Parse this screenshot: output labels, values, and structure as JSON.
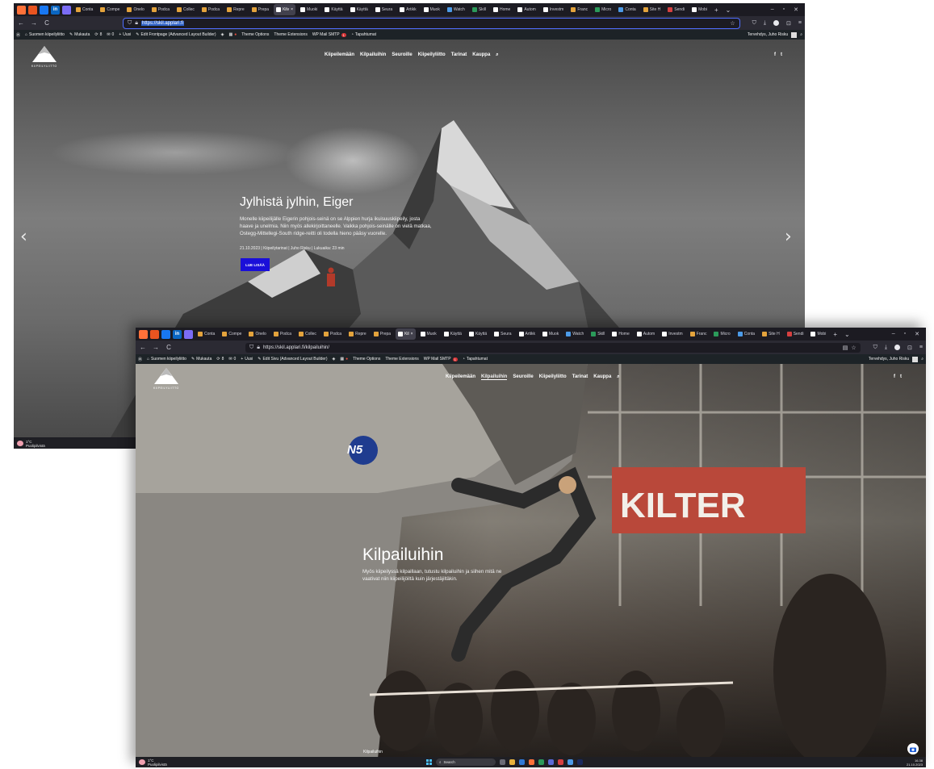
{
  "browser": {
    "pinned": [
      {
        "icon": "firefox-icon",
        "color": "#ff7139"
      },
      {
        "icon": "app-icon",
        "color": "#e95420"
      },
      {
        "icon": "facebook-icon",
        "color": "#1877f2"
      },
      {
        "icon": "linkedin-icon",
        "color": "#0a66c2",
        "glyph": "in"
      },
      {
        "icon": "app-square-icon",
        "color": "#7b6cf6"
      }
    ],
    "tabs": [
      "Conta",
      "Compe",
      "Onelo",
      "Podca",
      "Collec",
      "Podca",
      "Repre",
      "Prepa",
      "Kilv",
      "Muoki",
      "Käyttä",
      "Käyttä",
      "Seura",
      "Artikk",
      "Muok",
      "Watch",
      "Skill",
      "Home",
      "Autom",
      "Investm",
      "Franc",
      "Micro",
      "Conta",
      "Site H",
      "Sendi",
      "Mobi"
    ],
    "tabs_shot2": [
      "Conta",
      "Compe",
      "Onelo",
      "Podca",
      "Collec",
      "Podca",
      "Repre",
      "Prepa",
      "Kil",
      "Muok",
      "Käyttä",
      "Käyttä",
      "Seura",
      "Artikk",
      "Muok",
      "Watch",
      "Skill",
      "Home",
      "Autom",
      "Investm",
      "Franc",
      "Micro",
      "Conta",
      "Site H",
      "Sendi",
      "Mobi"
    ],
    "active_tab_index": 8,
    "new_tab": "+",
    "tab_list": "⌄",
    "win_controls": [
      "–",
      "▫",
      "✕"
    ],
    "url_shot1": "https://skil.applari.fi",
    "url_shot2": "https://skil.applari.fi/kilpailuihin/",
    "nav_icons": [
      "←",
      "→",
      "C"
    ]
  },
  "adminbar": {
    "site": "Suomen kiipeilyliitto",
    "customize": "Mukauta",
    "updates": "8",
    "comments": "0",
    "new": "Uusi",
    "edit_shot1": "Edit Frontpage (Advanced Layout Builder)",
    "edit_shot2": "Edit Sivu (Advanced Layout Builder)",
    "theme_options": "Theme Options",
    "theme_extensions": "Theme Extensions",
    "mail": "WP Mail SMTP",
    "mail_badge": "1",
    "events": "Tapahtumat",
    "greeting": "Tervehdys, Juho Risku"
  },
  "site": {
    "logo_text": "KIIPEILYLIITTO",
    "nav": [
      "Kiipeilemään",
      "Kilpailuihin",
      "Seuroille",
      "Kiipeilyliitto",
      "Tarinat",
      "Kauppa"
    ],
    "social": [
      "f",
      "t"
    ]
  },
  "shot1": {
    "title": "Jylhistä jylhin, Eiger",
    "text": "Monelle kiipeilijälle Eigerin pohjois-seinä on se Alppien hurja ikuisuuskiipeily, josta haave ja unelmia. Niin myös allekirjoittaneelle. Vaikka pohjois-seinälle on vielä matkaa, Ostegg-Mittellegi-South ridge-reitti oli todella hieno pääsy vuorelle.",
    "meta": "21.10.2023  |  Kiipeilytarinat  |  Juho Risku  |  Lukuaika: 23 min",
    "cta": "LUE LISÄÄ",
    "prev": "‹",
    "next": "›"
  },
  "shot2": {
    "title": "Kilpailuihin",
    "text": "Myös kiipeilyssä kilpaillaan, tutustu kilpailuihin ja siihen mitä ne vaativat niin kiipeilijöiltä kuin järjestäjiltäkin.",
    "footer": "Kilpailuihin",
    "hold_label": "N5",
    "banner": "KILTER"
  },
  "taskbar": {
    "temp": "1°C",
    "weather": "Puolipilvistä",
    "search": "Search",
    "time": "16.38",
    "date": "21.10.2023"
  },
  "colors": {
    "accent_button": "#1a0fd9",
    "admin_bar": "#1d2327",
    "browser_bg": "#1c1b22"
  }
}
